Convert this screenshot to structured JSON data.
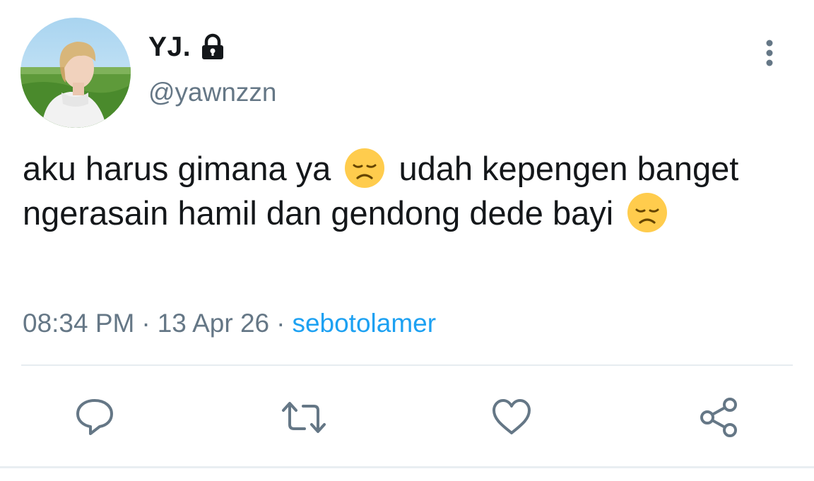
{
  "user": {
    "display_name": "YJ.",
    "handle": "@yawnzzn",
    "protected_icon": "lock-icon",
    "avatar": "profile-photo"
  },
  "tweet": {
    "text_part1": "aku harus gimana ya",
    "emoji1": "disappointed-face-emoji",
    "text_part2": "udah kepengen banget ngerasain hamil dan gendong dede bayi",
    "emoji2": "disappointed-face-emoji"
  },
  "meta": {
    "time": "08:34 PM",
    "separator": "·",
    "date": "13 Apr 26",
    "source": "sebotolamer"
  },
  "actions": [
    {
      "name": "reply",
      "icon": "comment-icon"
    },
    {
      "name": "retweet",
      "icon": "retweet-icon"
    },
    {
      "name": "like",
      "icon": "heart-icon"
    },
    {
      "name": "share",
      "icon": "share-icon"
    }
  ],
  "colors": {
    "text": "#14171a",
    "secondary": "#657786",
    "link": "#1da1f2",
    "divider": "#e6ecf0"
  }
}
